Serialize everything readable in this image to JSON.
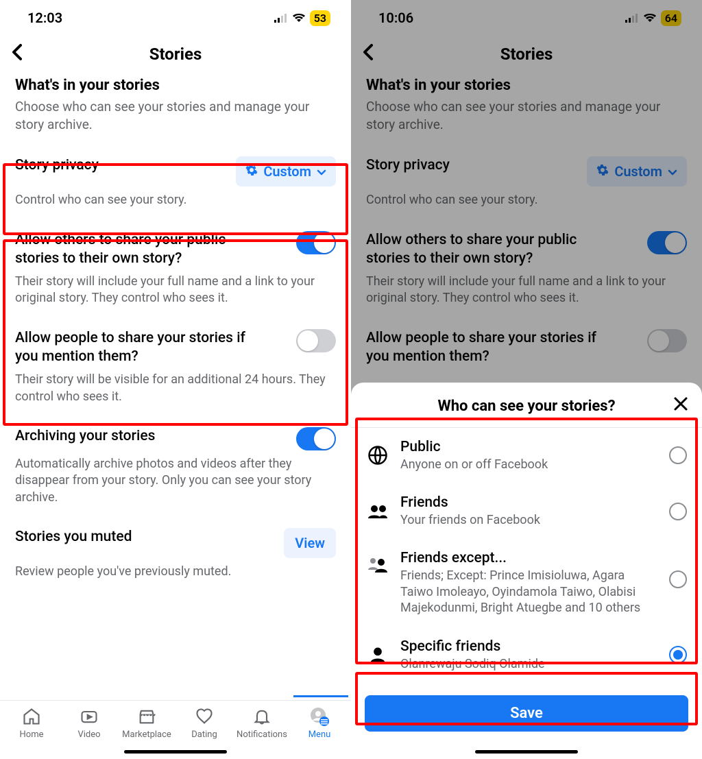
{
  "left": {
    "status_time": "12:03",
    "battery": "53",
    "header_title": "Stories",
    "section1_title": "What's in your stories",
    "section1_desc": "Choose who can see your stories and manage your story archive.",
    "privacy_title": "Story privacy",
    "privacy_btn": "Custom",
    "privacy_desc": "Control who can see your story.",
    "share_title": "Allow others to share your public stories to their own story?",
    "share_desc": "Their story will include your full name and a link to your original story. They control who sees it.",
    "mention_title": "Allow people to share your stories if you mention them?",
    "mention_desc": "Their story will be visible for an additional 24 hours. They control who sees it.",
    "archive_title": "Archiving your stories",
    "archive_desc": "Automatically archive photos and videos after they disappear from your story. Only you can see your story archive.",
    "muted_title": "Stories you muted",
    "muted_btn": "View",
    "muted_desc": "Review people you've previously muted.",
    "tabs": {
      "home": "Home",
      "video": "Video",
      "marketplace": "Marketplace",
      "dating": "Dating",
      "notifications": "Notifications",
      "menu": "Menu"
    }
  },
  "right": {
    "status_time": "10:06",
    "battery": "64",
    "header_title": "Stories",
    "section1_title": "What's in your stories",
    "section1_desc": "Choose who can see your stories and manage your story archive.",
    "privacy_title": "Story privacy",
    "privacy_btn": "Custom",
    "privacy_desc": "Control who can see your story.",
    "share_title": "Allow others to share your public stories to their own story?",
    "share_desc": "Their story will include your full name and a link to your original story. They control who sees it.",
    "mention_title": "Allow people to share your stories if you mention them?",
    "sheet_title": "Who can see your stories?",
    "opt_public_title": "Public",
    "opt_public_desc": "Anyone on or off Facebook",
    "opt_friends_title": "Friends",
    "opt_friends_desc": "Your friends on Facebook",
    "opt_except_title": "Friends except...",
    "opt_except_desc": "Friends; Except: Prince Imisioluwa, Agara Taiwo Imoleayo, Oyindamola Taiwo, Olabisi Majekodunmi, Bright Atuegbe and 10 others",
    "opt_specific_title": "Specific friends",
    "opt_specific_desc": "Olanrewaju Sodiq Olamide",
    "save_btn": "Save"
  }
}
